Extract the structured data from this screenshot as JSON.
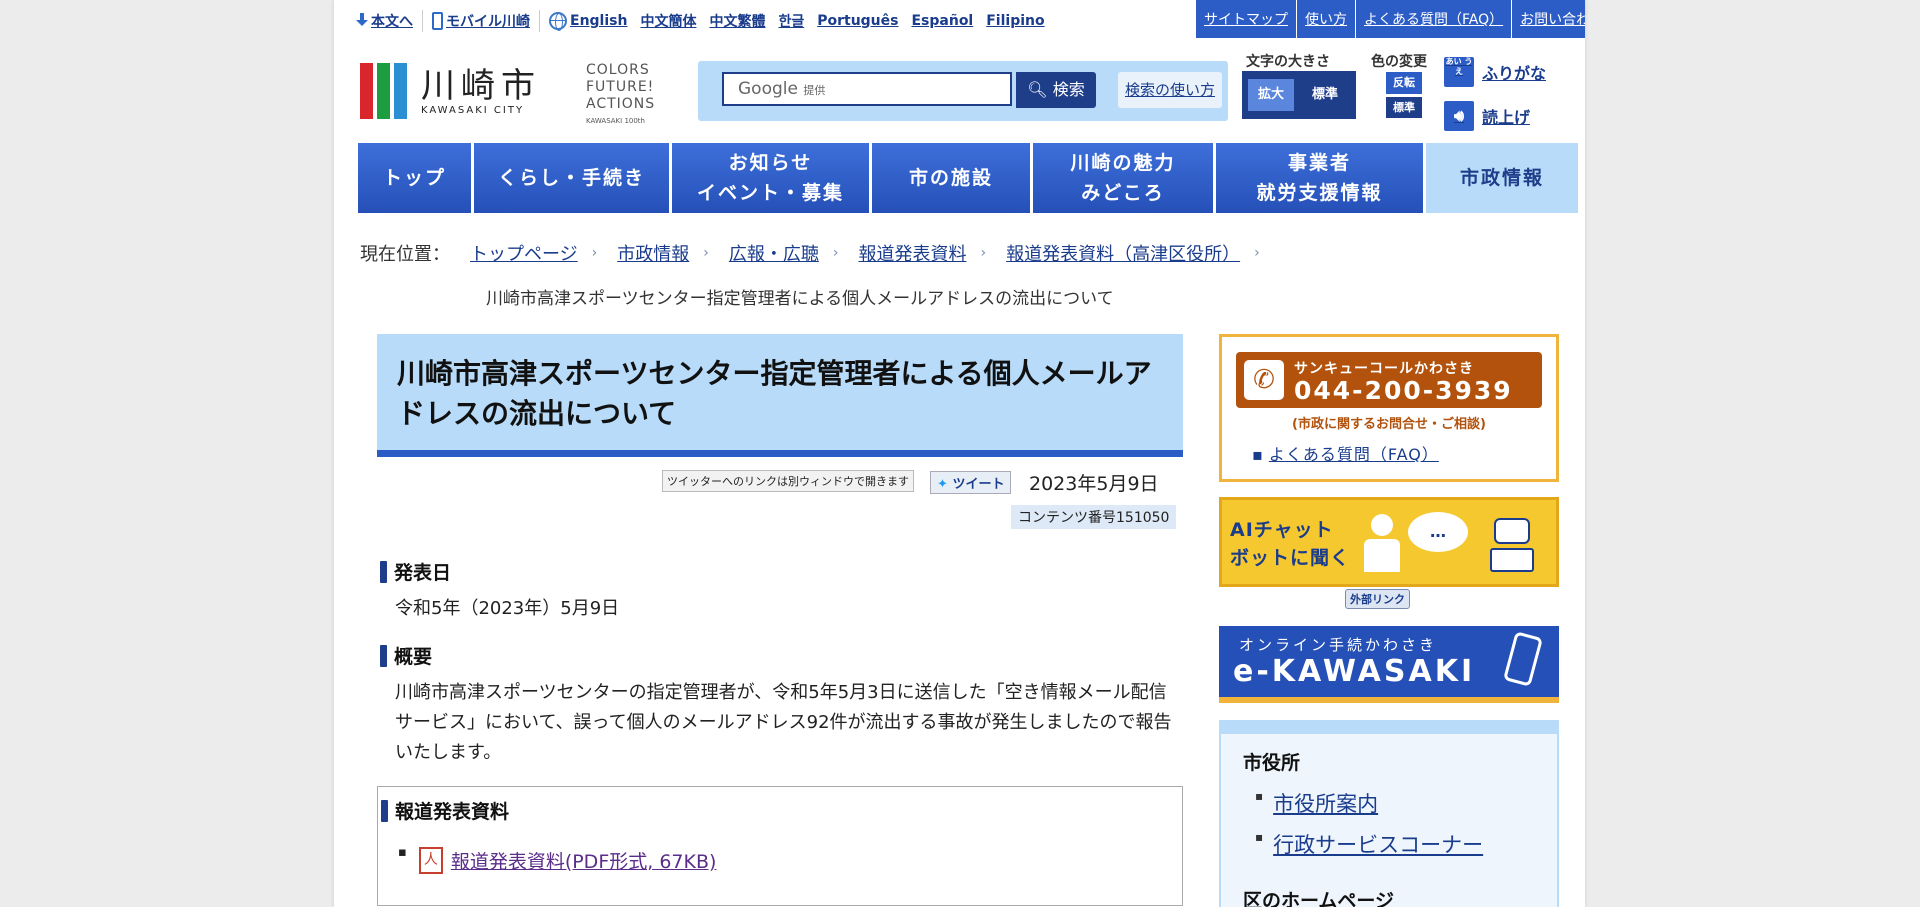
{
  "util_links": [
    {
      "label": "本文へ",
      "icon": "download-arrow-icon"
    },
    {
      "label": "モバイル川崎",
      "icon": "mobile-phone-icon"
    },
    {
      "label": "English",
      "icon": "globe-icon"
    },
    {
      "label": "中文簡体"
    },
    {
      "label": "中文繁體"
    },
    {
      "label": "한글"
    },
    {
      "label": "Português"
    },
    {
      "label": "Español"
    },
    {
      "label": "Filipino"
    }
  ],
  "top_nav": [
    "サイトマップ",
    "使い方",
    "よくある質問（FAQ）",
    "お問い合わせ"
  ],
  "logo": {
    "jp": "川崎市",
    "en": "KAWASAKI CITY",
    "bar_colors": [
      "#d9262c",
      "#1d9d3f",
      "#2a8fd3"
    ]
  },
  "tagline": {
    "l1": "COLORS",
    "l2": "FUTURE!",
    "l3": "ACTIONS",
    "l4": "KAWASAKI 100th"
  },
  "search": {
    "provider": "Google",
    "provider_small": "提供",
    "button": "検索",
    "help": "検索の使い方"
  },
  "text_size": {
    "title": "文字の大きさ",
    "large": "拡大",
    "normal": "標準"
  },
  "color_change": {
    "title": "色の変更",
    "invert": "反転",
    "normal": "標準"
  },
  "furigana": {
    "icon_text": "あい うえ",
    "label": "ふりがな"
  },
  "read_aloud": {
    "label": "読上げ"
  },
  "main_nav": [
    {
      "l1": "トップ",
      "l2": ""
    },
    {
      "l1": "くらし・手続き",
      "l2": ""
    },
    {
      "l1": "お知らせ",
      "l2": "イベント・募集"
    },
    {
      "l1": "市の施設",
      "l2": ""
    },
    {
      "l1": "川崎の魅力",
      "l2": "みどころ"
    },
    {
      "l1": "事業者",
      "l2": "就労支援情報"
    },
    {
      "l1": "市政情報",
      "l2": ""
    }
  ],
  "breadcrumb": {
    "label": "現在位置：",
    "items": [
      "トップページ",
      "市政情報",
      "広報・広聴",
      "報道発表資料",
      "報道発表資料（高津区役所）"
    ],
    "current": "川崎市高津スポーツセンター指定管理者による個人メールアドレスの流出について"
  },
  "article": {
    "title": "川崎市高津スポーツセンター指定管理者による個人メールアドレスの流出について",
    "tw_note": "ツイッターへのリンクは別ウィンドウで開きます",
    "tweet": "ツイート",
    "date": "2023年5月9日",
    "content_no": "コンテンツ番号151050",
    "sec1_title": "発表日",
    "sec1_body": "令和5年（2023年）5月9日",
    "sec2_title": "概要",
    "sec2_body": "川崎市高津スポーツセンターの指定管理者が、令和5年5月3日に送信した「空き情報メール配信サービス」において、誤って個人のメールアドレス92件が流出する事故が発生しましたので報告いたします。",
    "sec3_title": "報道発表資料",
    "pdf_link": "報道発表資料(PDF形式, 67KB)"
  },
  "side": {
    "call_name": "サンキューコールかわさき",
    "call_number": "044-200-3939",
    "call_sub": "(市政に関するお問合せ・ご相談)",
    "faq": "よくある質問（FAQ）",
    "ai_l1": "AIチャット",
    "ai_l2": "ボットに聞く",
    "ai_bubble": "…",
    "external": "外部リンク",
    "ek_l1": "オンライン手続かわさき",
    "ek_l2": "e-KAWASAKI",
    "cityhall_title": "市役所",
    "cityhall_links": [
      "市役所案内",
      "行政サービスコーナー"
    ],
    "ward_title": "区のホームページ"
  },
  "colors": {
    "primary": "#2c5cc5",
    "dark": "#1f3e8a",
    "light_blue": "#b7dbf8",
    "orange": "#f0b43c",
    "call_brown": "#b2520c"
  }
}
